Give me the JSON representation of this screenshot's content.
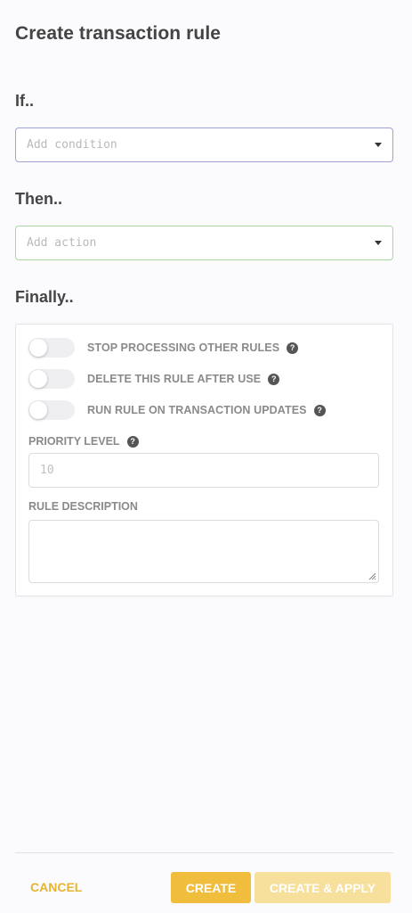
{
  "header": {
    "title": "Create transaction rule"
  },
  "if_section": {
    "heading": "If..",
    "condition_dropdown": {
      "placeholder": "Add condition"
    }
  },
  "then_section": {
    "heading": "Then..",
    "action_dropdown": {
      "placeholder": "Add action"
    }
  },
  "finally_section": {
    "heading": "Finally..",
    "toggles": [
      {
        "label": "STOP PROCESSING OTHER RULES",
        "enabled": false
      },
      {
        "label": "DELETE THIS RULE AFTER USE",
        "enabled": false
      },
      {
        "label": "RUN RULE ON TRANSACTION UPDATES",
        "enabled": false
      }
    ],
    "priority": {
      "label": "PRIORITY LEVEL",
      "placeholder": "10"
    },
    "description": {
      "label": "RULE DESCRIPTION",
      "value": ""
    }
  },
  "footer": {
    "cancel_label": "CANCEL",
    "create_label": "CREATE",
    "create_apply_label": "CREATE & APPLY"
  },
  "colors": {
    "accent": "#f1bd3c",
    "accent_disabled": "#f7df9c",
    "condition_border": "#9ea2d6",
    "action_border": "#a9d8a1"
  },
  "icons": {
    "help": "question-circle-icon",
    "dropdown": "caret-down-icon",
    "resize": "resize-handle-icon"
  }
}
